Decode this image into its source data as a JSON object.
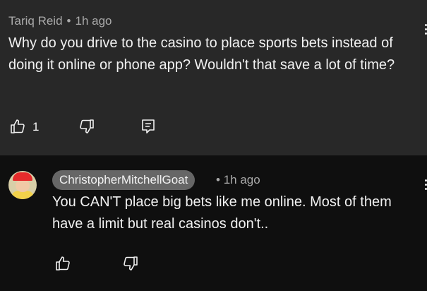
{
  "comment": {
    "author": "Tariq Reid",
    "separator": "•",
    "time": "1h ago",
    "text": "Why do you drive to the casino to place sports bets instead of doing it online or phone app? Wouldn't that save a lot of time?",
    "like_count": "1",
    "icons": {
      "like": "thumbs-up-icon",
      "dislike": "thumbs-down-icon",
      "reply": "reply-icon",
      "menu": "more-vert-icon"
    }
  },
  "reply": {
    "author": "ChristopherMitchellGoat",
    "separator": "•",
    "time": "1h ago",
    "text": "You CAN'T place big bets like me online. Most of them have a limit but real casinos don't..",
    "icons": {
      "like": "thumbs-up-icon",
      "dislike": "thumbs-down-icon",
      "menu": "more-vert-icon",
      "avatar": "user-avatar"
    }
  },
  "colors": {
    "top_bg": "#282828",
    "reply_bg": "#0f0f0f",
    "meta_text": "#aaaaaa",
    "main_text": "#f1f1f1",
    "handle_bg": "#666666"
  }
}
